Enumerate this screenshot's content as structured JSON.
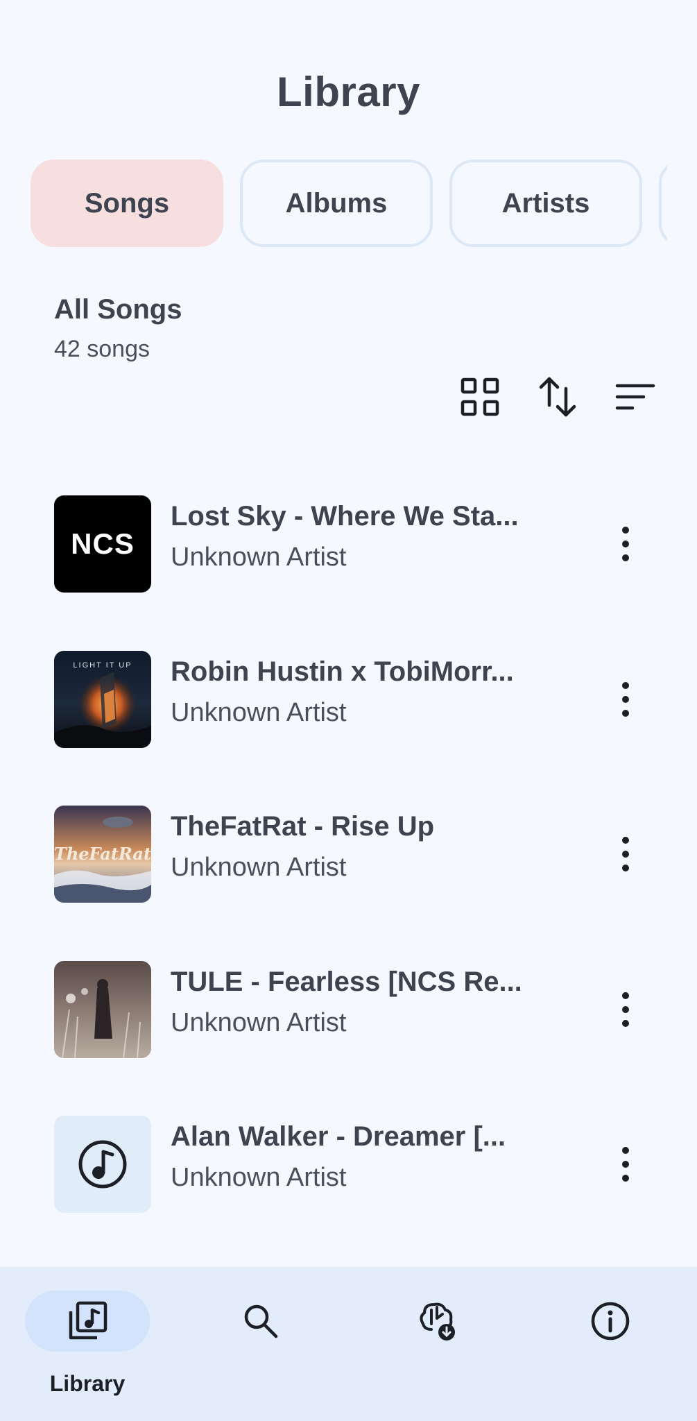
{
  "page": {
    "title": "Library"
  },
  "tabs": [
    {
      "label": "Songs",
      "active": true
    },
    {
      "label": "Albums",
      "active": false
    },
    {
      "label": "Artists",
      "active": false
    }
  ],
  "section": {
    "heading": "All Songs",
    "count": "42 songs"
  },
  "toolbar": {
    "icons": [
      "grid-view-icon",
      "sort-order-icon",
      "filter-icon"
    ]
  },
  "songs": [
    {
      "title": "Lost Sky - Where We Sta...",
      "artist": "Unknown Artist",
      "art": "NCS"
    },
    {
      "title": "Robin Hustin x TobiMorr...",
      "artist": "Unknown Artist",
      "art": "LIGHT IT UP"
    },
    {
      "title": "TheFatRat - Rise Up",
      "artist": "Unknown Artist",
      "art": "TheFatRat"
    },
    {
      "title": "TULE - Fearless [NCS Re...",
      "artist": "Unknown Artist",
      "art": ""
    },
    {
      "title": "Alan Walker - Dreamer [...",
      "artist": "Unknown Artist",
      "art": ""
    }
  ],
  "bottom_nav": {
    "items": [
      {
        "label": "Library",
        "icon": "library-music-icon",
        "active": true
      },
      {
        "label": "",
        "icon": "search-icon",
        "active": false
      },
      {
        "label": "",
        "icon": "ai-download-icon",
        "active": false
      },
      {
        "label": "",
        "icon": "info-icon",
        "active": false
      }
    ]
  },
  "colors": {
    "background": "#f5f8fe",
    "active_tab": "#f7dfe0",
    "nav_background": "#e2ecfa",
    "nav_active_pill": "#d2e3fb",
    "text": "#3d4450"
  }
}
